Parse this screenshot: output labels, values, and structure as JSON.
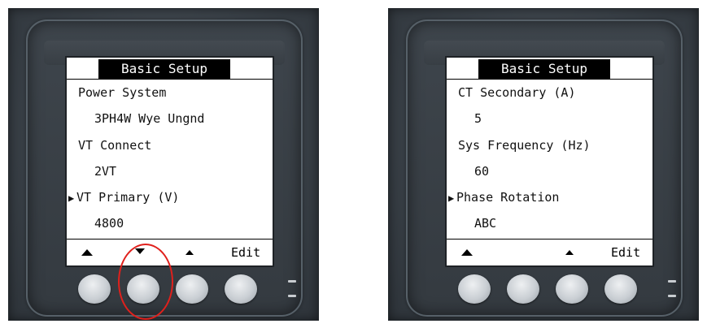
{
  "left_panel": {
    "title": "Basic Setup",
    "items": [
      {
        "label": "Power System",
        "value": "3PH4W Wye Ungnd"
      },
      {
        "label": "VT Connect",
        "value": "2VT"
      },
      {
        "label": "VT Primary (V)",
        "value": "4800",
        "selected": true
      }
    ],
    "softkeys": {
      "edit_label": "Edit"
    }
  },
  "right_panel": {
    "title": "Basic Setup",
    "items": [
      {
        "label": "CT Secondary (A)",
        "value": "5"
      },
      {
        "label": "Sys Frequency (Hz)",
        "value": "60"
      },
      {
        "label": "Phase Rotation",
        "value": "ABC",
        "selected": true
      }
    ],
    "softkeys": {
      "edit_label": "Edit"
    }
  },
  "colors": {
    "highlight_ring": "#e0201c",
    "device_body": "#3a4148",
    "screen_bg": "#ffffff"
  },
  "icons": {
    "selection_pointer": "pointer-icon",
    "up": "up-arrow-icon",
    "down": "down-arrow-icon"
  }
}
